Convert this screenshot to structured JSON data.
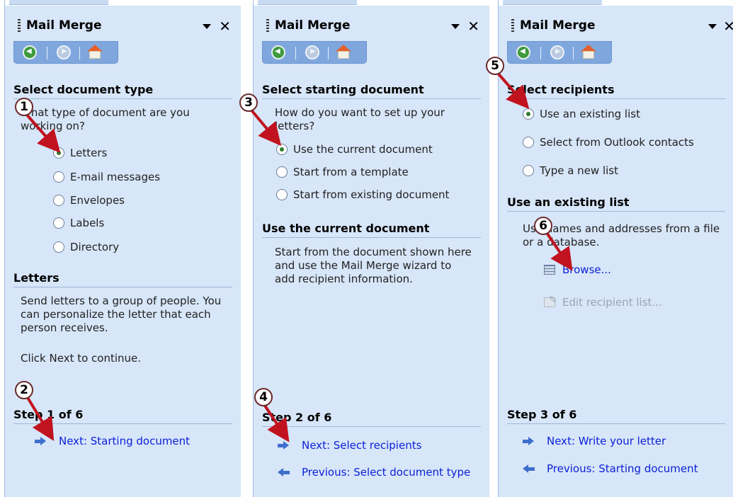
{
  "panels": [
    {
      "title": "Mail Merge",
      "section1": "Select document type",
      "question": "What type of document are you working on?",
      "options": [
        {
          "label": "Letters",
          "selected": true
        },
        {
          "label": "E-mail messages",
          "selected": false
        },
        {
          "label": "Envelopes",
          "selected": false
        },
        {
          "label": "Labels",
          "selected": false
        },
        {
          "label": "Directory",
          "selected": false
        }
      ],
      "section2": "Letters",
      "desc": "Send letters to a group of people. You can personalize the letter that each person receives.",
      "desc2": "Click Next to continue.",
      "step": "Step 1 of 6",
      "next": "Next: Starting document"
    },
    {
      "title": "Mail Merge",
      "section1": "Select starting document",
      "question": "How do you want to set up your letters?",
      "options": [
        {
          "label": "Use the current document",
          "selected": true
        },
        {
          "label": "Start from a template",
          "selected": false
        },
        {
          "label": "Start from existing document",
          "selected": false
        }
      ],
      "section2": "Use the current document",
      "desc": "Start from the document shown here and use the Mail Merge wizard to add recipient information.",
      "step": "Step 2 of 6",
      "next": "Next: Select recipients",
      "previous": "Previous: Select document type"
    },
    {
      "title": "Mail Merge",
      "section1": "Select recipients",
      "options": [
        {
          "label": "Use an existing list",
          "selected": true
        },
        {
          "label": "Select from Outlook contacts",
          "selected": false
        },
        {
          "label": "Type a new list",
          "selected": false
        }
      ],
      "section2": "Use an existing list",
      "desc": "Use names and addresses from a file or a database.",
      "browse": "Browse...",
      "edit": "Edit recipient list...",
      "step": "Step 3 of 6",
      "next": "Next: Write your letter",
      "previous": "Previous: Starting document"
    }
  ],
  "callouts": [
    "1",
    "2",
    "3",
    "4",
    "5",
    "6"
  ],
  "colors": {
    "panel": "#d7e6f8",
    "link": "#0b1fd6",
    "arrow": "#c1121f",
    "toolbar": "#7fa7de"
  },
  "icons": [
    "back-icon",
    "forward-icon",
    "home-icon",
    "dropdown-icon",
    "close-icon",
    "next-arrow-icon",
    "previous-arrow-icon",
    "browse-icon",
    "edit-list-icon"
  ]
}
